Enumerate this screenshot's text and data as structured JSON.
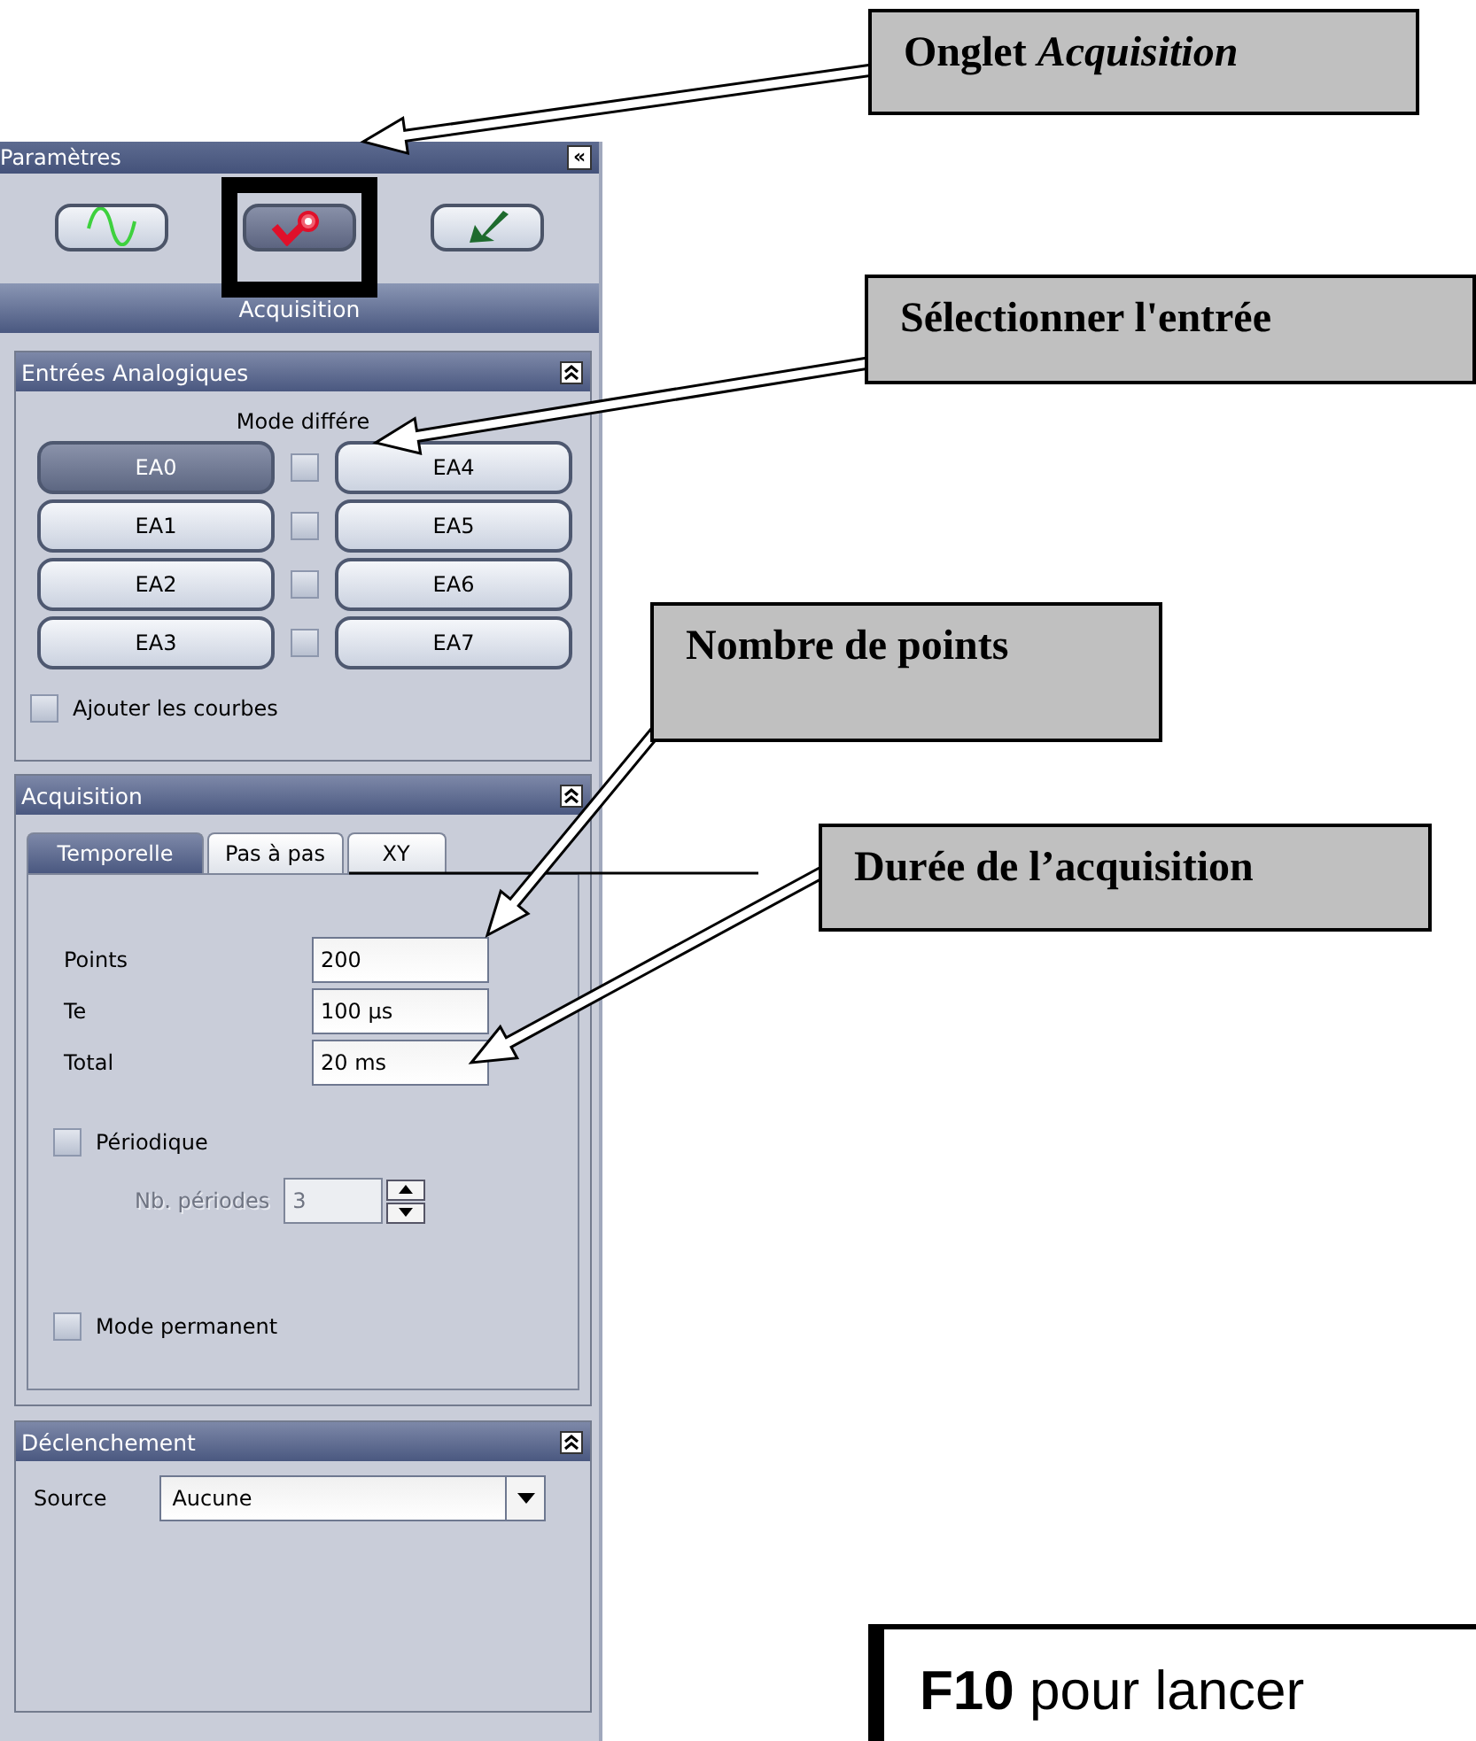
{
  "panel": {
    "title": "Paramètres",
    "collapse": "«",
    "mode_tabs": [
      {
        "kind": "wave",
        "selected": false
      },
      {
        "kind": "acquisition",
        "selected": true
      },
      {
        "kind": "check",
        "selected": false
      }
    ],
    "mode_label": "Acquisition",
    "inputs": {
      "title": "Entrées Analogiques",
      "caption": "Mode différe",
      "channels": [
        {
          "label": "EA0",
          "selected": true
        },
        {
          "label": "EA4",
          "selected": false
        },
        {
          "label": "EA1",
          "selected": false
        },
        {
          "label": "EA5",
          "selected": false
        },
        {
          "label": "EA2",
          "selected": false
        },
        {
          "label": "EA6",
          "selected": false
        },
        {
          "label": "EA3",
          "selected": false
        },
        {
          "label": "EA7",
          "selected": false
        }
      ],
      "differential": [
        {
          "checked": false
        },
        {
          "checked": false
        },
        {
          "checked": false
        },
        {
          "checked": false
        }
      ],
      "add_curves": {
        "label": "Ajouter les courbes",
        "checked": false
      }
    },
    "acquisition": {
      "title": "Acquisition",
      "tabs": [
        {
          "label": "Temporelle",
          "selected": true
        },
        {
          "label": "Pas à pas",
          "selected": false
        },
        {
          "label": "XY",
          "selected": false
        }
      ],
      "fields": [
        {
          "label": "Points",
          "value": "200"
        },
        {
          "label": "Te",
          "value": "100 µs"
        },
        {
          "label": "Total",
          "value": "20 ms"
        }
      ],
      "periodic": {
        "label": "Périodique",
        "checked": false
      },
      "periods": {
        "label": "Nb. périodes",
        "value": "3",
        "disabled": true
      },
      "permanent": {
        "label": "Mode permanent",
        "checked": false
      }
    },
    "trigger": {
      "title": "Déclenchement",
      "source_label": "Source",
      "source_value": "Aucune"
    }
  },
  "callouts": [
    {
      "text": "Onglet *Acquisition*"
    },
    {
      "text": "Sélectionner l'entrée"
    },
    {
      "text": "Nombre de points"
    },
    {
      "text": "Durée de l’acquisition"
    }
  ],
  "footer_note": "**F10** pour lancer"
}
